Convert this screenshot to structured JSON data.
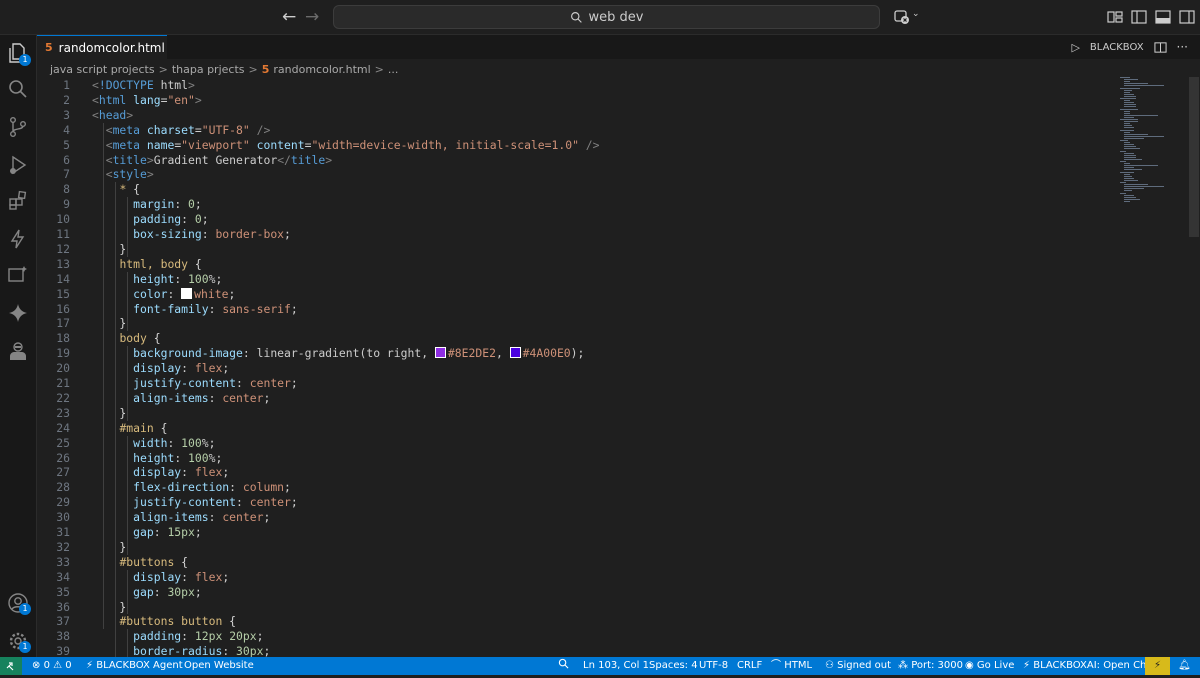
{
  "titlebar": {
    "search_text": "web dev"
  },
  "tab": {
    "filename": "randomcolor.html",
    "file_icon": "html5-icon"
  },
  "editor_actions": {
    "run_label": "BLACKBOX"
  },
  "breadcrumb": {
    "items": [
      "java script projects",
      "thapa prjects",
      "randomcolor.html",
      "..."
    ]
  },
  "activity_badges": {
    "explorer": "1",
    "accounts": "1",
    "manage": "1"
  },
  "code": {
    "line_numbers": [
      "1",
      "2",
      "3",
      "4",
      "5",
      "6",
      "7",
      "8",
      "9",
      "10",
      "11",
      "12",
      "13",
      "14",
      "15",
      "16",
      "17",
      "18",
      "19",
      "20",
      "21",
      "22",
      "23",
      "24",
      "25",
      "26",
      "27",
      "28",
      "29",
      "30",
      "31",
      "32",
      "33",
      "34",
      "35",
      "36",
      "37",
      "38",
      "39"
    ],
    "lines": [
      "<!DOCTYPE html>",
      "<html lang=\"en\">",
      "<head>",
      "  <meta charset=\"UTF-8\" />",
      "  <meta name=\"viewport\" content=\"width=device-width, initial-scale=1.0\" />",
      "  <title>Gradient Generator</title>",
      "  <style>",
      "    * {",
      "      margin: 0;",
      "      padding: 0;",
      "      box-sizing: border-box;",
      "    }",
      "    html, body {",
      "      height: 100%;",
      "      color: white;",
      "      font-family: sans-serif;",
      "    }",
      "    body {",
      "      background-image: linear-gradient(to right, #8E2DE2, #4A00E0);",
      "      display: flex;",
      "      justify-content: center;",
      "      align-items: center;",
      "    }",
      "    #main {",
      "      width: 100%;",
      "      height: 100%;",
      "      display: flex;",
      "      flex-direction: column;",
      "      justify-content: center;",
      "      align-items: center;",
      "      gap: 15px;",
      "    }",
      "    #buttons {",
      "      display: flex;",
      "      gap: 30px;",
      "    }",
      "    #buttons button {",
      "      padding: 12px 20px;",
      "      border-radius: 30px;"
    ],
    "color_swatches": [
      "#FFFFFF",
      "#8E2DE2",
      "#4A00E0"
    ]
  },
  "statusbar": {
    "problems_errors": "0",
    "problems_warnings": "0",
    "blackbox_agent": "BLACKBOX Agent",
    "open_website": "Open Website",
    "position": "Ln 103, Col 1",
    "spaces": "Spaces: 4",
    "encoding": "UTF-8",
    "eol": "CRLF",
    "language": "HTML",
    "signed_out": "Signed out",
    "port": "Port: 3000",
    "go_live": "Go Live",
    "blackboxai_chat": "BLACKBOXAI: Open Chat"
  },
  "colors": {
    "accent": "#0078d4",
    "remote": "#16825d",
    "editor_bg": "#1f1f1f"
  }
}
